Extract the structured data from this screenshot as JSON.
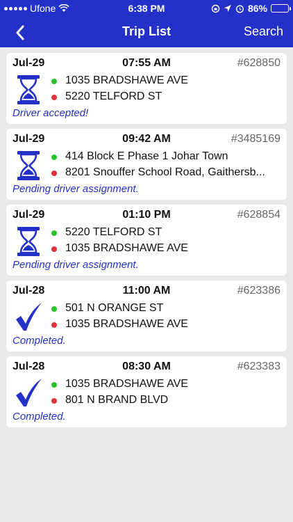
{
  "status_bar": {
    "carrier": "Ufone",
    "time": "6:38 PM",
    "battery": "86%",
    "battery_level": 0.86,
    "battery_color": "#3fdc4b"
  },
  "navbar": {
    "title": "Trip List",
    "search_label": "Search"
  },
  "colors": {
    "accent": "#2431c9",
    "pickup_dot": "#2bc32b",
    "dropoff_dot": "#e0313a"
  },
  "trips": [
    {
      "date": "Jul-29",
      "time": "07:55 AM",
      "id": "#628850",
      "icon": "hourglass-icon",
      "pickup": "1035 BRADSHAWE AVE",
      "dropoff": "5220 TELFORD ST",
      "status": "Driver accepted!"
    },
    {
      "date": "Jul-29",
      "time": "09:42 AM",
      "id": "#3485169",
      "icon": "hourglass-icon",
      "pickup": "414 Block E Phase 1 Johar Town",
      "dropoff": "8201 Snouffer School Road, Gaithersb...",
      "status": "Pending driver assignment."
    },
    {
      "date": "Jul-29",
      "time": "01:10 PM",
      "id": "#628854",
      "icon": "hourglass-icon",
      "pickup": "5220 TELFORD ST",
      "dropoff": "1035 BRADSHAWE AVE",
      "status": "Pending driver assignment."
    },
    {
      "date": "Jul-28",
      "time": "11:00 AM",
      "id": "#623386",
      "icon": "checkmark-icon",
      "pickup": "501 N ORANGE ST",
      "dropoff": "1035 BRADSHAWE AVE",
      "status": "Completed."
    },
    {
      "date": "Jul-28",
      "time": "08:30 AM",
      "id": "#623383",
      "icon": "checkmark-icon",
      "pickup": "1035 BRADSHAWE AVE",
      "dropoff": "801 N BRAND BLVD",
      "status": "Completed."
    }
  ]
}
